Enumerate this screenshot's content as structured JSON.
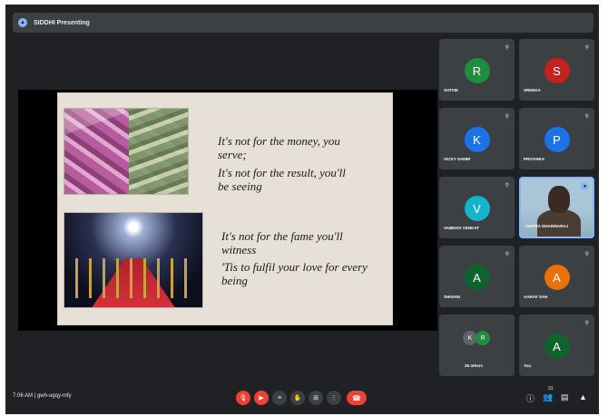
{
  "topbar": {
    "presenting_label": "SIDDHI Presenting",
    "present_icon": "screen-share-icon"
  },
  "slide": {
    "line1": "It's not for the money, you",
    "line2": "serve;",
    "line3": "It's not for the result, you'll",
    "line4": "be seeing",
    "line5": "It's not for the fame you'll",
    "line6": "witness",
    "line7": "'Tis to fulfil your love for every",
    "line8": "being"
  },
  "participants": [
    {
      "name": "SATVIK",
      "initial": "R",
      "color": "#1e8e3e"
    },
    {
      "name": "SREEKA",
      "initial": "S",
      "color": "#c5221f"
    },
    {
      "name": "VICKY SAMIR",
      "initial": "K",
      "color": "#1a73e8"
    },
    {
      "name": "PRIYANKA",
      "initial": "P",
      "color": "#1a73e8"
    },
    {
      "name": "VAIBHAV VENKAT",
      "initial": "V",
      "color": "#12b5cb"
    },
    {
      "name": "CHITRA DHARMARAJ",
      "initial": "",
      "color": "#000000"
    },
    {
      "name": "SHIVANI",
      "initial": "A",
      "color": "#0d652d"
    },
    {
      "name": "AARAV SAH",
      "initial": "A",
      "color": "#e8710a"
    }
  ],
  "others_tile": {
    "label": "25 others",
    "initial_a": "K",
    "initial_b": "R",
    "color_a": "#5f6368",
    "color_b": "#1e8e3e"
  },
  "you_tile": {
    "label": "You",
    "initial": "A",
    "color": "#0d652d"
  },
  "bottombar": {
    "time": "7:06 AM",
    "separator": "|",
    "meeting_code": "gwh-ugqy-mfy",
    "controls": [
      {
        "icon": "mic-off-icon",
        "glyph": "🎙"
      },
      {
        "icon": "camera-off-icon",
        "glyph": "▶"
      },
      {
        "icon": "captions-icon",
        "glyph": "≡"
      },
      {
        "icon": "raise-hand-icon",
        "glyph": "✋"
      },
      {
        "icon": "present-icon",
        "glyph": "⊞"
      },
      {
        "icon": "more-options-icon",
        "glyph": "⋮"
      },
      {
        "icon": "hang-up-icon",
        "glyph": "☎"
      }
    ],
    "right": [
      {
        "icon": "info-icon",
        "glyph": "ⓘ"
      },
      {
        "icon": "people-icon",
        "glyph": "👥"
      },
      {
        "icon": "chat-icon",
        "glyph": "▤"
      },
      {
        "icon": "activities-icon",
        "glyph": "▲"
      }
    ],
    "people_count": "31"
  }
}
